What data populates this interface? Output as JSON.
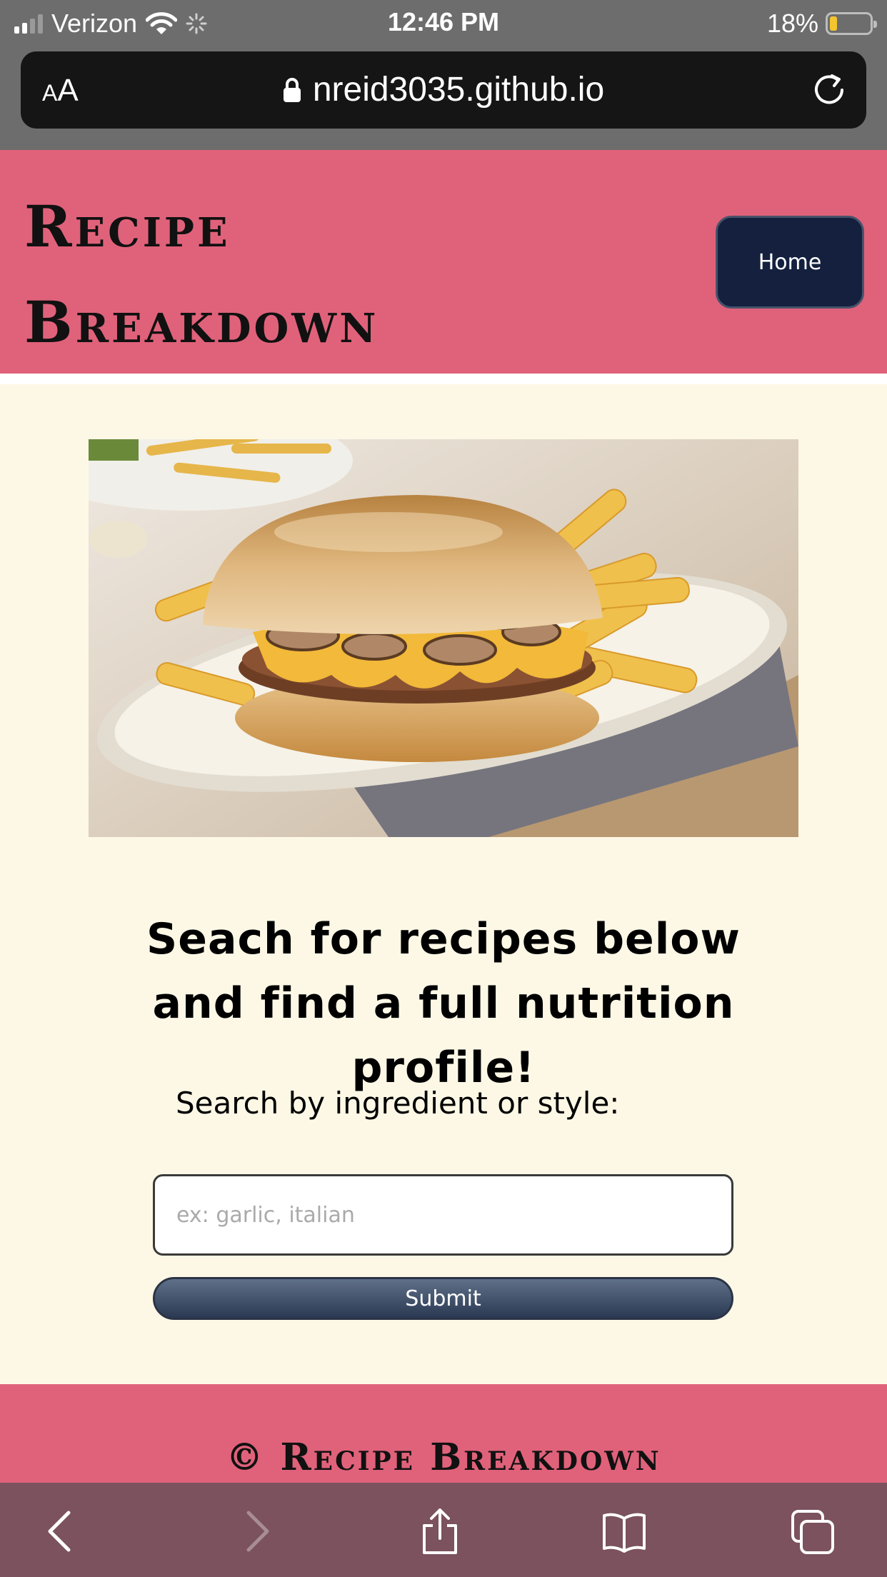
{
  "status_bar": {
    "carrier": "Verizon",
    "time": "12:46 PM",
    "battery": "18%",
    "battery_level": 0.18
  },
  "browser": {
    "text_size_small": "A",
    "text_size_large": "A",
    "url": "nreid3035.github.io",
    "icons": {
      "lock": "lock-icon",
      "reload": "reload-icon"
    }
  },
  "header": {
    "title": "Recipe Breakdown",
    "nav": {
      "home_label": "Home"
    },
    "colors": {
      "background": "#e0627a",
      "button": "#14203e"
    }
  },
  "main": {
    "image_alt": "Mushroom Swiss cheeseburger with fries",
    "tagline": "Seach for recipes below and find a full nutrition profile!",
    "search": {
      "label": "Search by ingredient or style:",
      "value": "",
      "placeholder": "ex: garlic, italian",
      "submit_label": "Submit"
    },
    "colors": {
      "background": "#fdf8e6"
    }
  },
  "footer": {
    "text": "© Recipe Breakdown"
  },
  "toolbar": {
    "icons": [
      "back-icon",
      "forward-icon",
      "share-icon",
      "bookmarks-icon",
      "tabs-icon"
    ]
  }
}
